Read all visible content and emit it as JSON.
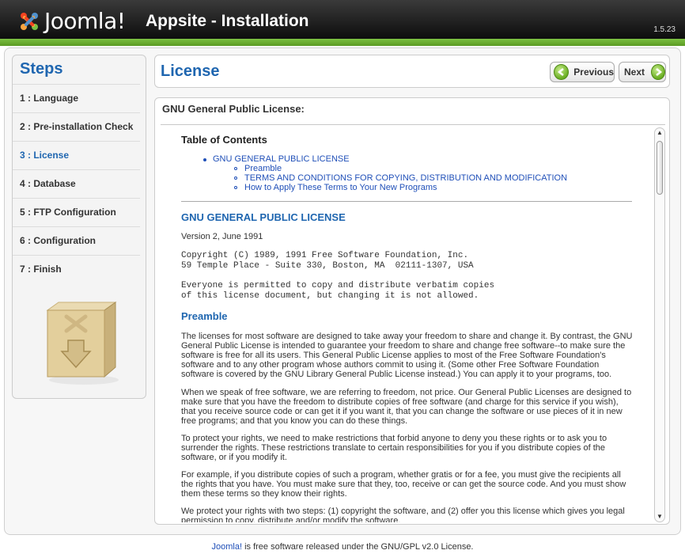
{
  "header": {
    "logo_text": "Joomla!",
    "title": "Appsite - Installation",
    "version": "1.5.23"
  },
  "steps": {
    "title": "Steps",
    "items": [
      {
        "label": "1 : Language",
        "active": false
      },
      {
        "label": "2 : Pre-installation Check",
        "active": false
      },
      {
        "label": "3 : License",
        "active": true
      },
      {
        "label": "4 : Database",
        "active": false
      },
      {
        "label": "5 : FTP Configuration",
        "active": false
      },
      {
        "label": "6 : Configuration",
        "active": false
      },
      {
        "label": "7 : Finish",
        "active": false
      }
    ]
  },
  "license_bar": {
    "title": "License",
    "previous_label": "Previous",
    "next_label": "Next"
  },
  "content": {
    "heading": "GNU General Public License:",
    "toc_title": "Table of Contents",
    "toc_main": "GNU GENERAL PUBLIC LICENSE",
    "toc_sub": [
      "Preamble",
      "TERMS AND CONDITIONS FOR COPYING, DISTRIBUTION AND MODIFICATION",
      "How to Apply These Terms to Your New Programs"
    ],
    "license_title": "GNU GENERAL PUBLIC LICENSE",
    "version_line": "Version 2, June 1991",
    "copyright": "Copyright (C) 1989, 1991 Free Software Foundation, Inc.\n59 Temple Place - Suite 330, Boston, MA  02111-1307, USA",
    "verbatim": "Everyone is permitted to copy and distribute verbatim copies\nof this license document, but changing it is not allowed.",
    "preamble_title": "Preamble",
    "paragraphs": [
      "The licenses for most software are designed to take away your freedom to share and change it. By contrast, the GNU General Public License is intended to guarantee your freedom to share and change free software--to make sure the software is free for all its users. This General Public License applies to most of the Free Software Foundation's software and to any other program whose authors commit to using it. (Some other Free Software Foundation software is covered by the GNU Library General Public License instead.) You can apply it to your programs, too.",
      "When we speak of free software, we are referring to freedom, not price. Our General Public Licenses are designed to make sure that you have the freedom to distribute copies of free software (and charge for this service if you wish), that you receive source code or can get it if you want it, that you can change the software or use pieces of it in new free programs; and that you know you can do these things.",
      "To protect your rights, we need to make restrictions that forbid anyone to deny you these rights or to ask you to surrender the rights. These restrictions translate to certain responsibilities for you if you distribute copies of the software, or if you modify it.",
      "For example, if you distribute copies of such a program, whether gratis or for a fee, you must give the recipients all the rights that you have. You must make sure that they, too, receive or can get the source code. And you must show them these terms so they know their rights.",
      "We protect your rights with two steps: (1) copyright the software, and (2) offer you this license which gives you legal permission to copy, distribute and/or modify the software."
    ]
  },
  "footer": {
    "link_text": "Joomla!",
    "text": " is free software released under the GNU/GPL v2.0 License."
  },
  "colors": {
    "accent_blue": "#1f66b0",
    "header_green": "#6aae22",
    "header_dark": "#111111"
  },
  "icons": [
    "joomla-logo-icon",
    "previous-arrow-icon",
    "next-arrow-icon",
    "install-box-icon",
    "scroll-up-icon",
    "scroll-down-icon"
  ]
}
